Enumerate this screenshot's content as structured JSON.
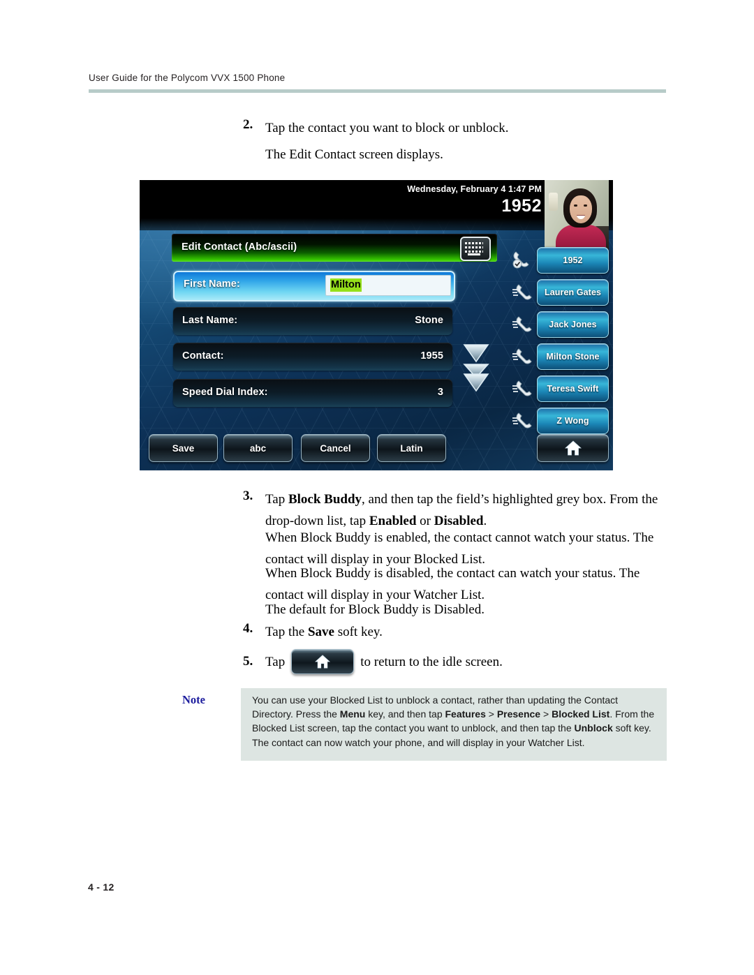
{
  "page": {
    "running_header": "User Guide for the Polycom VVX 1500 Phone",
    "footer": "4 - 12"
  },
  "steps": [
    {
      "number": "2.",
      "line1": "Tap the contact you want to block or unblock.",
      "line2": "The Edit Contact screen displays."
    },
    {
      "number": "3.",
      "p1_a": "Tap ",
      "p1_b1": "Block Buddy",
      "p1_c": ", and then tap the field’s highlighted grey box. From the drop-down list, tap ",
      "p1_b2": "Enabled",
      "p1_d": " or ",
      "p1_b3": "Disabled",
      "p1_e": ".",
      "p2": "When Block Buddy is enabled, the contact cannot watch your status. The contact will display in your Blocked List.",
      "p3": "When Block Buddy is disabled, the contact can watch your status. The contact will display in your Watcher List.",
      "p4": "The default for Block Buddy is Disabled."
    },
    {
      "number": "4.",
      "a": "Tap the ",
      "b": "Save",
      "c": " soft key."
    },
    {
      "number": "5.",
      "a": "Tap",
      "icon": "home-icon",
      "c": "to return to the idle screen."
    }
  ],
  "phone_screen": {
    "status_bar": {
      "date_time": "Wednesday, February 4  1:47 PM",
      "extension": "1952"
    },
    "video_thumbnail": "self-view-video",
    "title_bar": {
      "title": "Edit Contact (Abc/ascii)",
      "keyboard_icon": "keyboard-icon"
    },
    "fields": [
      {
        "label": "First Name:",
        "value": "Milton",
        "selected": true,
        "editing": true
      },
      {
        "label": "Last Name:",
        "value": "Stone",
        "selected": false,
        "editing": false
      },
      {
        "label": "Contact:",
        "value": "1955",
        "selected": false,
        "editing": false
      },
      {
        "label": "Speed Dial Index:",
        "value": "3",
        "selected": false,
        "editing": false
      }
    ],
    "scroll_indicators": [
      "scroll-down-icon",
      "scroll-page-down-icon"
    ],
    "line_keys": [
      {
        "label": "1952",
        "icon": "handset-registered-icon"
      },
      {
        "label": "Lauren Gates",
        "icon": "handset-icon"
      },
      {
        "label": "Jack Jones",
        "icon": "handset-icon"
      },
      {
        "label": "Milton Stone",
        "icon": "handset-icon"
      },
      {
        "label": "Teresa Swift",
        "icon": "handset-icon"
      },
      {
        "label": "Z Wong",
        "icon": "handset-icon"
      }
    ],
    "soft_keys": [
      {
        "label": "Save"
      },
      {
        "label": "abc"
      },
      {
        "label": "Cancel"
      },
      {
        "label": "Latin"
      }
    ],
    "home_key": "home-icon"
  },
  "note": {
    "label": "Note",
    "t1": "You can use your Blocked List to unblock a contact, rather than updating the Contact Directory. Press the ",
    "b1": "Menu",
    "t2": " key, and then tap ",
    "b2": "Features",
    "t3": " > ",
    "b3": "Presence",
    "t4": " > ",
    "b4": "Blocked List",
    "t5": ". From the Blocked List screen, tap the contact you want to unblock, and then tap the ",
    "b5": "Unblock",
    "t6": " soft key. The contact can now watch your phone, and will display in your Watcher List."
  },
  "colors": {
    "header_rule": "#b7cbc8",
    "note_background": "#dde5e2",
    "note_label": "#1d1d9e",
    "selected_field": "#2fa4e8",
    "highlight_text_bg": "#95e01a"
  }
}
